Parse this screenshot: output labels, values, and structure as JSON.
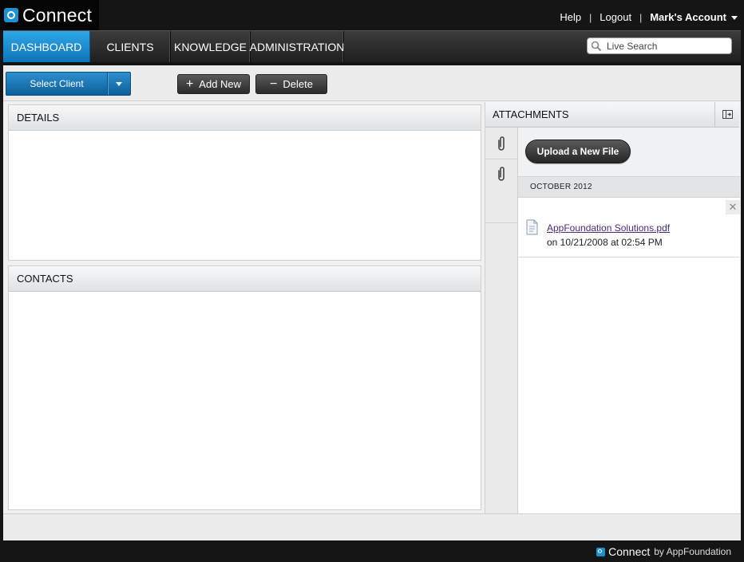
{
  "app": {
    "name": "Connect"
  },
  "top_links": {
    "help": "Help",
    "logout": "Logout",
    "account": "Mark's Account",
    "separator": "|"
  },
  "nav": {
    "tabs": [
      {
        "label": "DASHBOARD"
      },
      {
        "label": "CLIENTS"
      },
      {
        "label": "KNOWLEDGE"
      },
      {
        "label": "ADMINISTRATION"
      }
    ],
    "active_tab": "DASHBOARD"
  },
  "search": {
    "placeholder": "Live Search",
    "icon": "search-icon"
  },
  "toolbar": {
    "select_client": "Select Client",
    "add_new": "Add New",
    "delete": "Delete",
    "add_icon": "+",
    "delete_icon": "−"
  },
  "panels": {
    "details_title": "DETAILS",
    "contacts_title": "CONTACTS"
  },
  "attachments": {
    "title": "ATTACHMENTS",
    "upload_label": "Upload a New File",
    "groups": [
      {
        "date_label": "OCTOBER 2012",
        "files": [
          {
            "name": "AppFoundation Solutions.pdf",
            "meta": "on 10/21/2008 at 02:54 PM",
            "close": "✕"
          }
        ]
      }
    ]
  },
  "footer": {
    "brand": "Connect",
    "by": "by AppFoundation"
  },
  "colors": {
    "accent": "#1e8fd0",
    "tab_active": "#1a8ad0",
    "link": "#4b2a7b",
    "background": "#151515"
  }
}
